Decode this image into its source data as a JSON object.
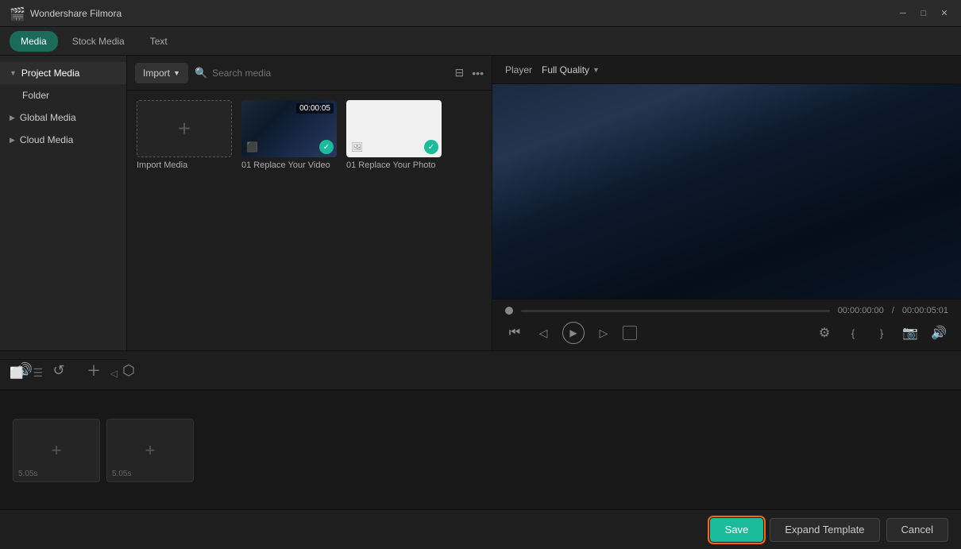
{
  "app": {
    "title": "Wondershare Filmora",
    "logo": "🎬"
  },
  "titlebar": {
    "title": "Wondershare Filmora",
    "minimize_label": "─",
    "maximize_label": "□",
    "close_label": "✕"
  },
  "tabs": [
    {
      "id": "media",
      "label": "Media",
      "active": true
    },
    {
      "id": "stock",
      "label": "Stock Media",
      "active": false
    },
    {
      "id": "text",
      "label": "Text",
      "active": false
    }
  ],
  "sidebar": {
    "items": [
      {
        "id": "project-media",
        "label": "Project Media",
        "arrow": "▼",
        "active": true,
        "indent": 0
      },
      {
        "id": "folder",
        "label": "Folder",
        "indent": 1
      },
      {
        "id": "global-media",
        "label": "Global Media",
        "arrow": "▶",
        "indent": 0
      },
      {
        "id": "cloud-media",
        "label": "Cloud Media",
        "arrow": "▶",
        "indent": 0
      }
    ],
    "bottom_icons": [
      "new-folder-icon",
      "list-icon"
    ]
  },
  "media_toolbar": {
    "import_label": "Import",
    "search_placeholder": "Search media"
  },
  "media_items": [
    {
      "id": "import",
      "type": "import",
      "label": "Import Media",
      "thumb_type": "import"
    },
    {
      "id": "video1",
      "type": "video",
      "label": "01 Replace Your Video",
      "duration": "00:00:05",
      "has_check": true,
      "thumb_type": "video"
    },
    {
      "id": "photo1",
      "type": "photo",
      "label": "01 Replace Your Photo",
      "has_check": true,
      "thumb_type": "photo"
    }
  ],
  "player": {
    "label": "Player",
    "quality": "Full Quality",
    "current_time": "00:00:00:00",
    "total_time": "00:00:05:01",
    "time_separator": "/"
  },
  "controls": {
    "rewind": "⏮",
    "step_back": "◁",
    "play": "▶",
    "step_forward": "▷",
    "stop": "□"
  },
  "toolbar": {
    "icons": [
      "speaker-icon",
      "scissors-icon",
      "crop-icon",
      "transform-icon"
    ]
  },
  "timeline": {
    "clips": [
      {
        "id": "clip1",
        "duration": "5.05s"
      },
      {
        "id": "clip2",
        "duration": "5.05s"
      }
    ]
  },
  "actions": {
    "save_label": "Save",
    "expand_label": "Expand Template",
    "cancel_label": "Cancel"
  }
}
